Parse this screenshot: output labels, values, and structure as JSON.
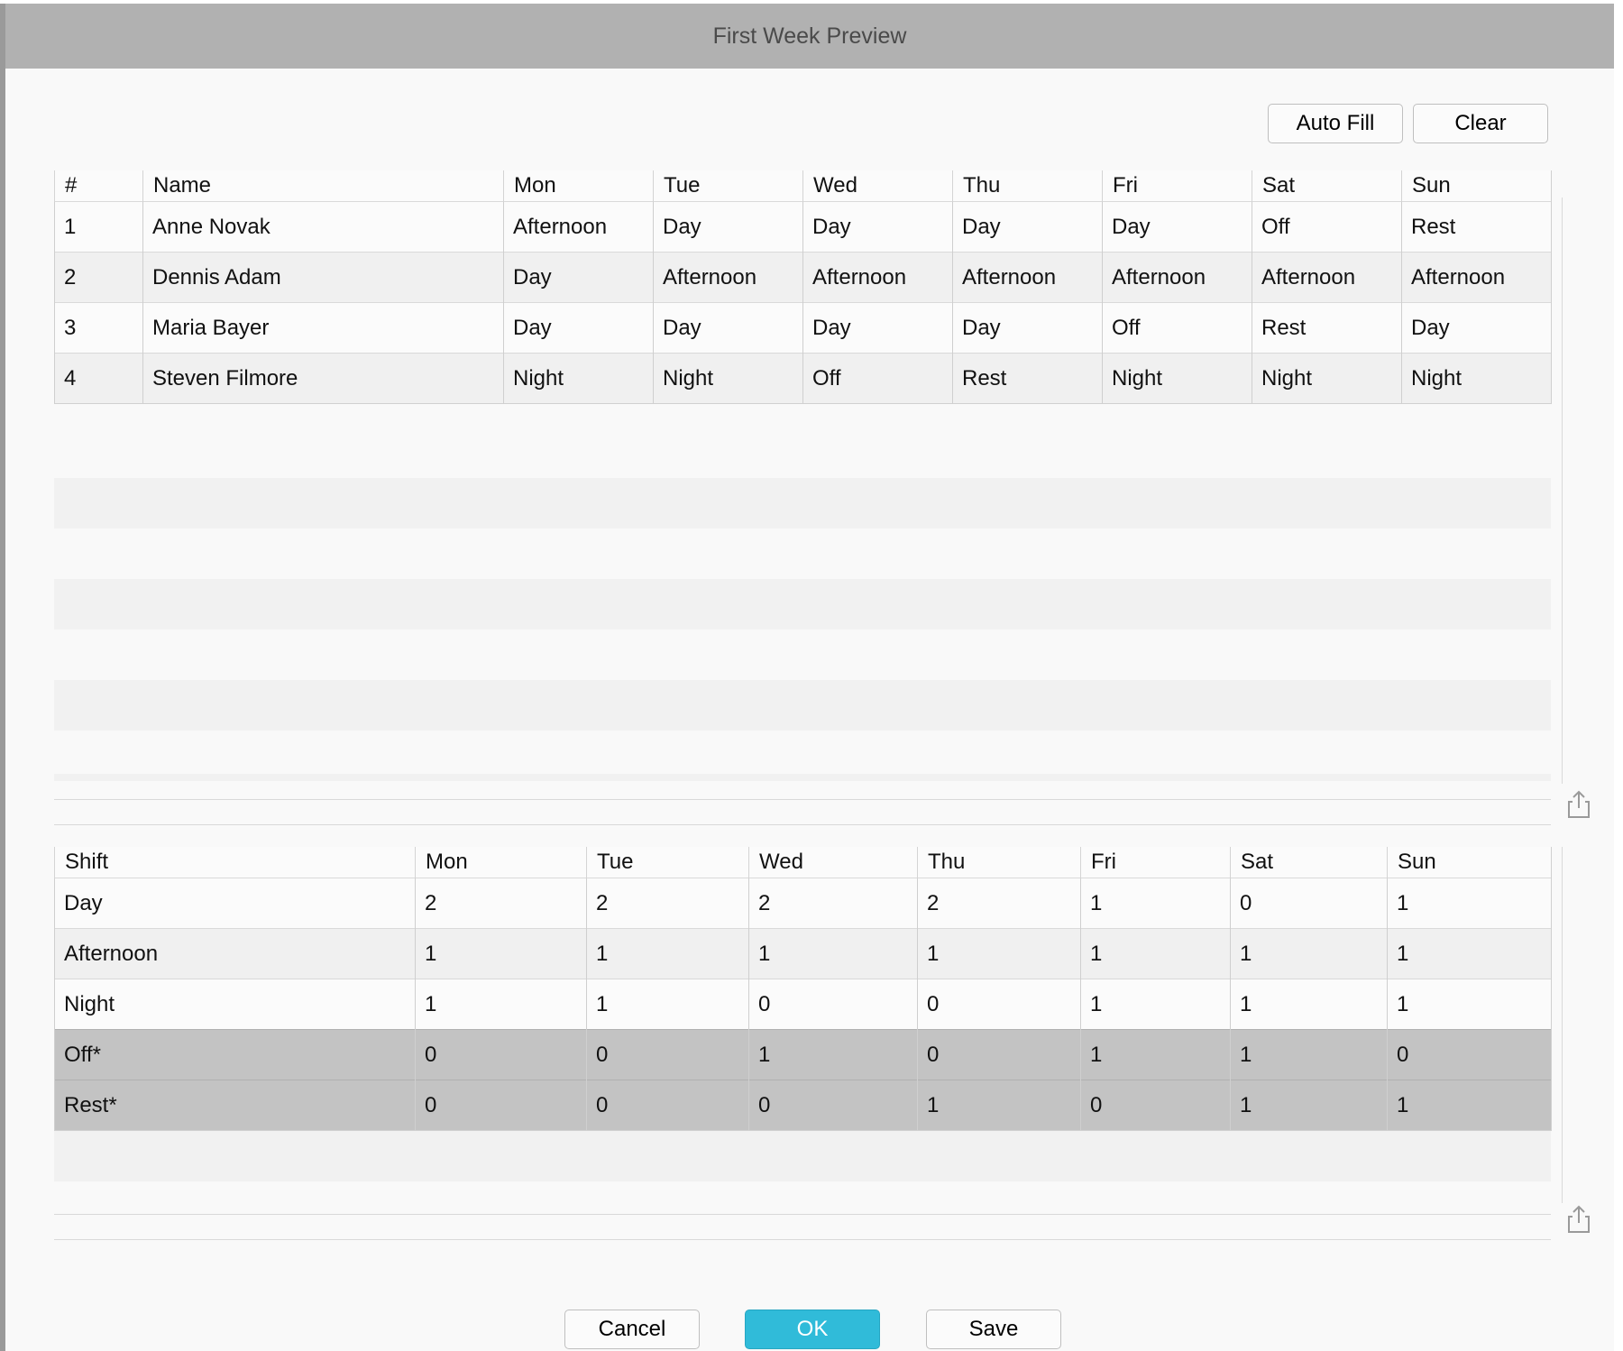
{
  "window": {
    "title": "First Week Preview"
  },
  "toolbar": {
    "autofill_label": "Auto Fill",
    "clear_label": "Clear"
  },
  "schedule": {
    "headers": [
      "#",
      "Name",
      "Mon",
      "Tue",
      "Wed",
      "Thu",
      "Fri",
      "Sat",
      "Sun"
    ],
    "rows": [
      [
        "1",
        "Anne Novak",
        "Afternoon",
        "Day",
        "Day",
        "Day",
        "Day",
        "Off",
        "Rest"
      ],
      [
        "2",
        "Dennis Adam",
        "Day",
        "Afternoon",
        "Afternoon",
        "Afternoon",
        "Afternoon",
        "Afternoon",
        "Afternoon"
      ],
      [
        "3",
        "Maria Bayer",
        "Day",
        "Day",
        "Day",
        "Day",
        "Off",
        "Rest",
        "Day"
      ],
      [
        "4",
        "Steven Filmore",
        "Night",
        "Night",
        "Off",
        "Rest",
        "Night",
        "Night",
        "Night"
      ]
    ],
    "export_icon": "share-export-icon"
  },
  "summary": {
    "headers": [
      "Shift",
      "Mon",
      "Tue",
      "Wed",
      "Thu",
      "Fri",
      "Sat",
      "Sun"
    ],
    "rows": [
      [
        "Day",
        "2",
        "2",
        "2",
        "2",
        "1",
        "0",
        "1"
      ],
      [
        "Afternoon",
        "1",
        "1",
        "1",
        "1",
        "1",
        "1",
        "1"
      ],
      [
        "Night",
        "1",
        "1",
        "0",
        "0",
        "1",
        "1",
        "1"
      ],
      [
        "Off*",
        "0",
        "0",
        "1",
        "0",
        "1",
        "1",
        "0"
      ],
      [
        "Rest*",
        "0",
        "0",
        "0",
        "1",
        "0",
        "1",
        "1"
      ]
    ],
    "export_icon": "share-export-icon"
  },
  "footer": {
    "cancel_label": "Cancel",
    "ok_label": "OK",
    "save_label": "Save"
  },
  "colors": {
    "title_bar": "#b1b1b1",
    "ok_button": "#30bbd9",
    "highlight_row": "#c3c3c3"
  }
}
